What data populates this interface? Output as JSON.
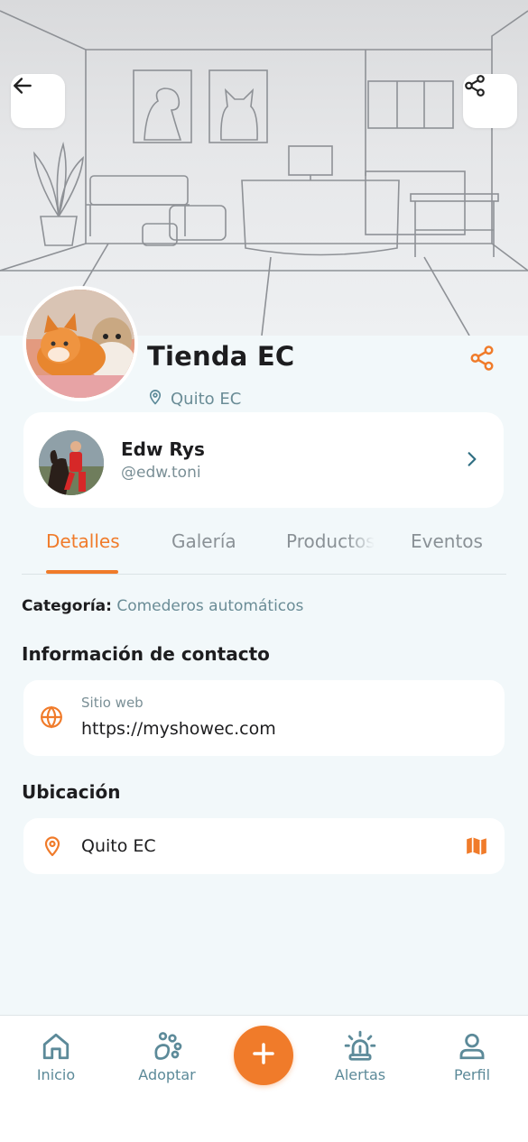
{
  "header": {
    "back_icon": "arrow-left-icon",
    "share_icon": "share-icon"
  },
  "profile": {
    "name": "Tienda EC",
    "location": "Quito EC",
    "location_icon": "map-pin-icon",
    "share_icon": "share-icon"
  },
  "owner": {
    "name": "Edw Rys",
    "handle": "@edw.toni"
  },
  "tabs": [
    {
      "label": "Detalles",
      "active": true
    },
    {
      "label": "Galería",
      "active": false
    },
    {
      "label": "Productos",
      "active": false
    },
    {
      "label": "Eventos",
      "active": false
    }
  ],
  "details": {
    "category_label": "Categoría:",
    "category_value": "Comederos automáticos",
    "contact_title": "Información de contacto",
    "website_label": "Sitio web",
    "website_value": "https://myshowec.com",
    "location_title": "Ubicación",
    "location_value": "Quito EC"
  },
  "bottom_nav": [
    {
      "label": "Inicio",
      "icon": "home-icon"
    },
    {
      "label": "Adoptar",
      "icon": "paw-icon"
    },
    {
      "label": "Alertas",
      "icon": "siren-icon"
    },
    {
      "label": "Perfil",
      "icon": "user-icon"
    }
  ],
  "colors": {
    "accent": "#f07b2a",
    "muted_teal": "#6a8c96",
    "background": "#f2f8fa",
    "card": "#ffffff"
  }
}
